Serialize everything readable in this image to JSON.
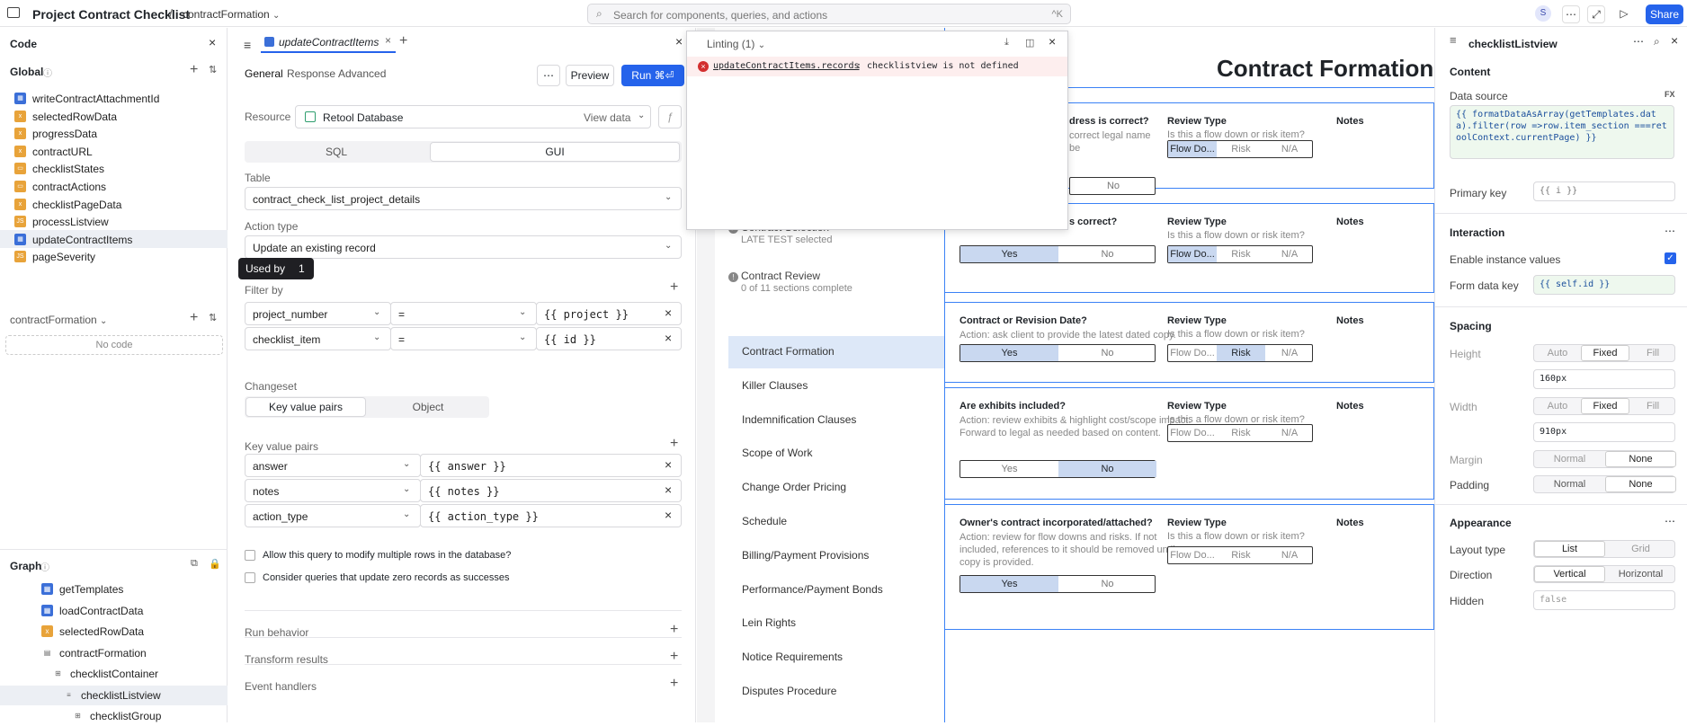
{
  "topbar": {
    "app_title": "Project Contract Checklist",
    "separator": "/",
    "page_name": "contractFormation",
    "search_placeholder": "Search for components, queries, and actions",
    "search_shortcut": "^K",
    "avatar_initial": "S",
    "share_label": "Share"
  },
  "code_panel": {
    "title": "Code",
    "global_label": "Global",
    "global_items": [
      {
        "name": "writeContractAttachmentId",
        "icon": "query-icon"
      },
      {
        "name": "selectedRowData",
        "icon": "variable-icon"
      },
      {
        "name": "progressData",
        "icon": "variable-icon"
      },
      {
        "name": "contractURL",
        "icon": "variable-icon"
      },
      {
        "name": "checklistStates",
        "icon": "transformer-icon"
      },
      {
        "name": "contractActions",
        "icon": "transformer-icon"
      },
      {
        "name": "checklistPageData",
        "icon": "variable-icon"
      },
      {
        "name": "processListview",
        "icon": "js-icon"
      },
      {
        "name": "updateContractItems",
        "icon": "query-icon"
      },
      {
        "name": "pageSeverity",
        "icon": "js-icon"
      }
    ],
    "page_section": "contractFormation",
    "no_code": "No code",
    "graph_title": "Graph",
    "graph_items": [
      {
        "name": "getTemplates",
        "icon": "query-icon"
      },
      {
        "name": "loadContractData",
        "icon": "query-icon"
      },
      {
        "name": "selectedRowData",
        "icon": "variable-icon"
      },
      {
        "name": "contractFormation",
        "icon": "page-icon"
      },
      {
        "name": "checklistContainer",
        "icon": "container-icon"
      },
      {
        "name": "checklistListview",
        "icon": "listview-icon"
      },
      {
        "name": "checklistGroup",
        "icon": "container-icon"
      }
    ]
  },
  "tooltip": {
    "label": "Used by",
    "count": "1"
  },
  "editor": {
    "tab_name": "updateContractItems",
    "subtabs": [
      "General",
      "Response",
      "Advanced"
    ],
    "preview_label": "Preview",
    "run_label": "Run ⌘⏎",
    "resource_label": "Resource",
    "resource_value": "Retool Database",
    "view_data": "View data",
    "mode_tabs": [
      "SQL",
      "GUI"
    ],
    "table_label": "Table",
    "table_value": "contract_check_list_project_details",
    "action_type_label": "Action type",
    "action_type_value": "Update an existing record",
    "filter_by_label": "Filter by",
    "filters": [
      {
        "field": "project_number",
        "op": "=",
        "value": "{{ project }}"
      },
      {
        "field": "checklist_item",
        "op": "=",
        "value": "{{ id }}"
      }
    ],
    "changeset_label": "Changeset",
    "changeset_tabs": [
      "Key value pairs",
      "Object"
    ],
    "kv_label": "Key value pairs",
    "kv_pairs": [
      {
        "key": "answer",
        "value": "{{ answer }}"
      },
      {
        "key": "notes",
        "value": "{{ notes }}"
      },
      {
        "key": "action_type",
        "value": "{{ action_type }}"
      }
    ],
    "checkbox1": "Allow this query to modify multiple rows in the database?",
    "checkbox2": "Consider queries that update zero records as successes",
    "sections": [
      "Run behavior",
      "Transform results",
      "Event handlers"
    ]
  },
  "lint": {
    "title": "Linting (1)",
    "error_code": "updateContractItems.records",
    "error_msg": ": checklistview is not defined"
  },
  "app": {
    "heading": "Contract Formation",
    "nav_top": [
      {
        "title": "Contract Selection",
        "subtitle": "LATE TEST selected"
      },
      {
        "title": "Contract Review",
        "subtitle": "0 of 11 sections complete"
      }
    ],
    "nav_items": [
      "Contract Formation",
      "Killer Clauses",
      "Indemnification Clauses",
      "Scope of Work",
      "Change Order Pricing",
      "Schedule",
      "Billing/Payment Provisions",
      "Performance/Payment Bonds",
      "Lein Rights",
      "Notice Requirements",
      "Disputes Procedure"
    ],
    "review_type_label": "Review Type",
    "review_type_hint": "Is this a flow down or risk item?",
    "notes_label": "Notes",
    "yes": "Yes",
    "no": "No",
    "review_options": [
      "Flow Do...",
      "Risk",
      "N/A"
    ],
    "cards": [
      {
        "question": "dress is correct?",
        "action": "correct legal name be",
        "answer": "none",
        "review": "Flow Do..."
      },
      {
        "question": "s correct?",
        "action": "",
        "answer": "Yes",
        "review": "Flow Do..."
      },
      {
        "question": "Contract or Revision Date?",
        "action": "Action: ask client to provide the latest dated copy.",
        "answer": "Yes",
        "review": "Risk"
      },
      {
        "question": "Are exhibits included?",
        "action": "Action: review exhibits & highlight cost/scope impact. Forward to legal as needed based on content.",
        "answer": "No",
        "review": "none"
      },
      {
        "question": "Owner's contract incorporated/attached?",
        "action": "Action: review for flow downs and risks. If not included, references to it should be removed until a copy is provided.",
        "answer": "Yes",
        "review": "none"
      }
    ]
  },
  "inspector": {
    "title": "checklistListview",
    "content_label": "Content",
    "data_source_label": "Data source",
    "fx": "FX",
    "data_source_code": "{{ formatDataAsArray(getTemplates.data).filter(row =>row.item_section ===retoolContext.currentPage) }}",
    "primary_key_label": "Primary key",
    "primary_key_value": "{{ i }}",
    "interaction_label": "Interaction",
    "enable_instance_label": "Enable instance values",
    "form_data_key_label": "Form data key",
    "form_data_key_value": "{{ self.id }}",
    "spacing_label": "Spacing",
    "height_label": "Height",
    "size_options": [
      "Auto",
      "Fixed",
      "Fill"
    ],
    "height_value": "160px",
    "width_label": "Width",
    "width_value": "910px",
    "margin_label": "Margin",
    "margin_options": [
      "Normal",
      "None"
    ],
    "padding_label": "Padding",
    "padding_options": [
      "Normal",
      "None"
    ],
    "appearance_label": "Appearance",
    "layout_type_label": "Layout type",
    "layout_options": [
      "List",
      "Grid"
    ],
    "direction_label": "Direction",
    "direction_options": [
      "Vertical",
      "Horizontal"
    ],
    "hidden_label": "Hidden",
    "hidden_value": "false"
  },
  "colors": {
    "accent": "#2563eb",
    "selected_nav": "#dde8f8",
    "card_border": "#3b82f6",
    "error": "#d32f2f"
  }
}
